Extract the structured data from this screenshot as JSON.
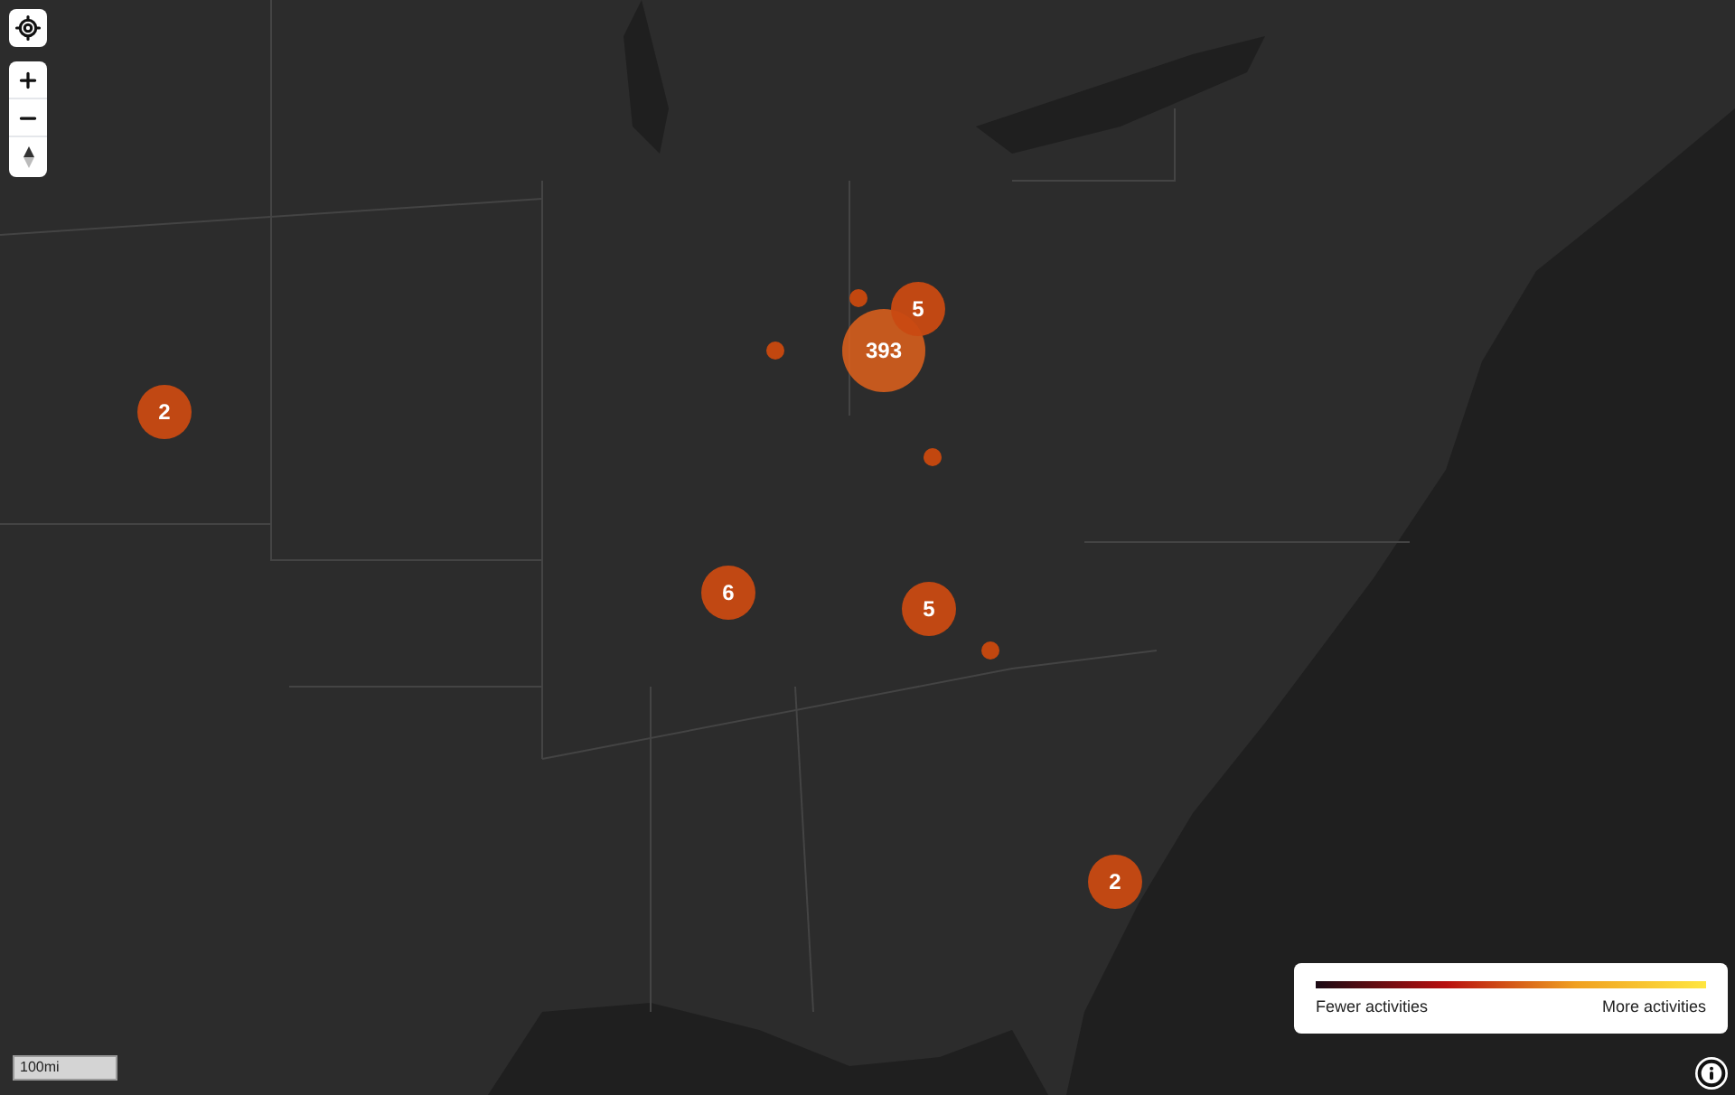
{
  "markers": [
    {
      "kind": "cluster",
      "count": "2"
    },
    {
      "kind": "point"
    },
    {
      "kind": "point"
    },
    {
      "kind": "cluster",
      "count": "393"
    },
    {
      "kind": "cluster",
      "count": "5"
    },
    {
      "kind": "point"
    },
    {
      "kind": "cluster",
      "count": "6"
    },
    {
      "kind": "cluster",
      "count": "5"
    },
    {
      "kind": "point"
    },
    {
      "kind": "cluster",
      "count": "2"
    }
  ],
  "legend": {
    "min_label": "Fewer activities",
    "max_label": "More activities"
  },
  "scale": {
    "label": "100mi"
  }
}
